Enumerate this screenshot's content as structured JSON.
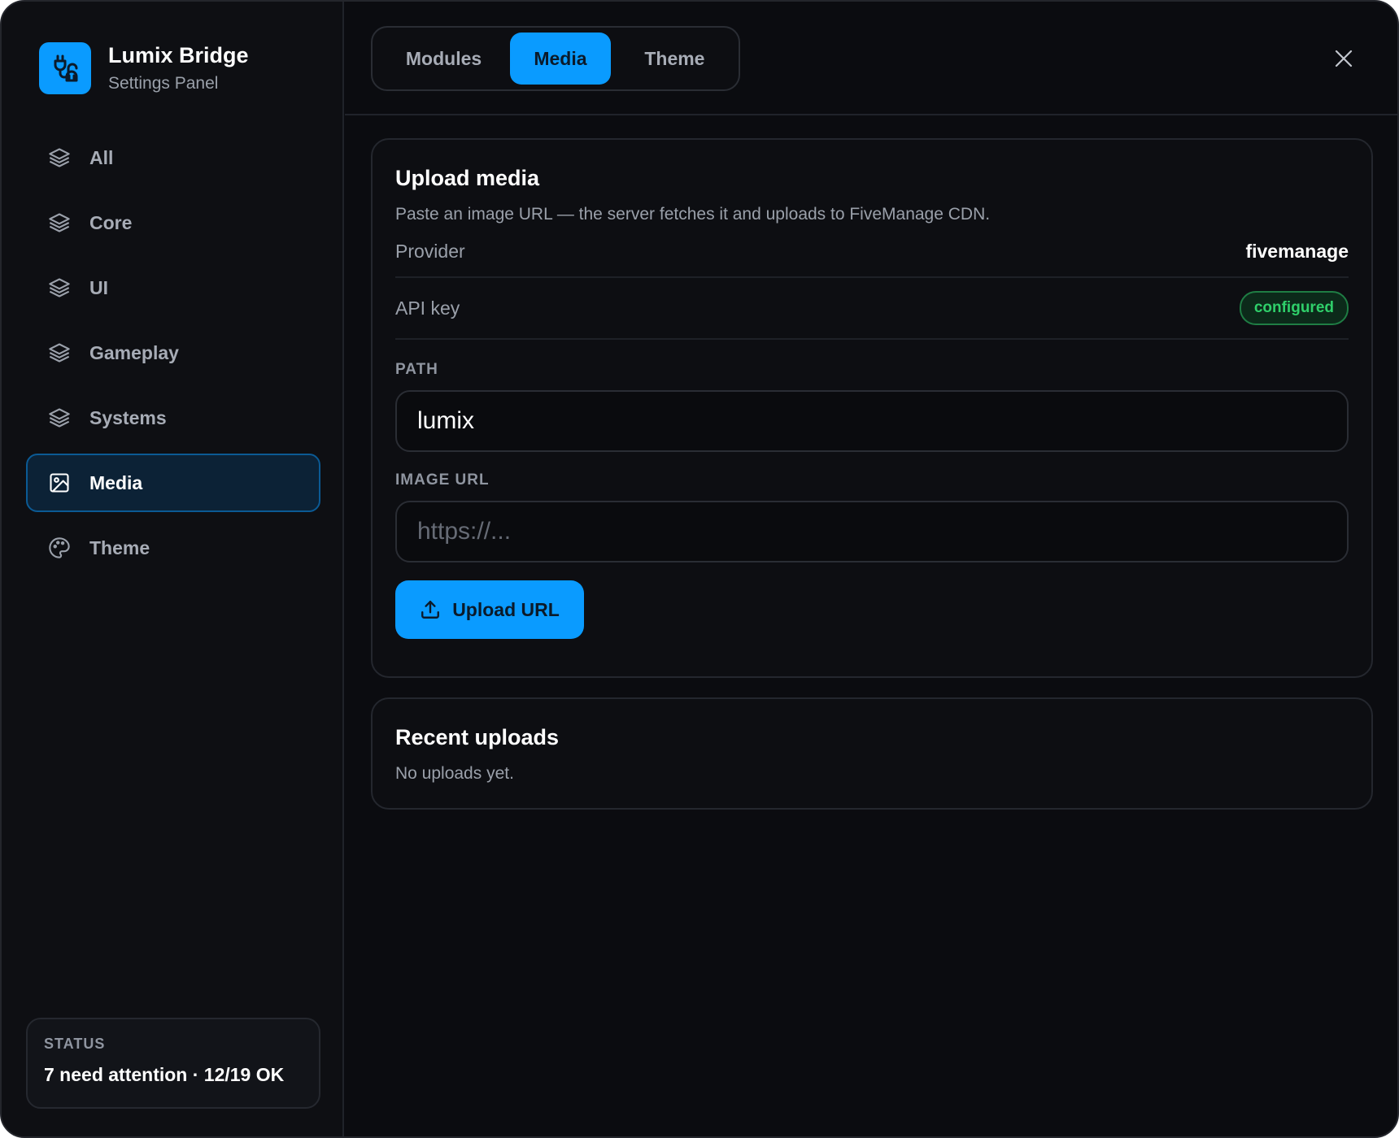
{
  "brand": {
    "title": "Lumix Bridge",
    "subtitle": "Settings Panel"
  },
  "sidebar": {
    "items": [
      {
        "label": "All",
        "icon": "layers-icon"
      },
      {
        "label": "Core",
        "icon": "layers-icon"
      },
      {
        "label": "UI",
        "icon": "layers-icon"
      },
      {
        "label": "Gameplay",
        "icon": "layers-icon"
      },
      {
        "label": "Systems",
        "icon": "layers-icon"
      },
      {
        "label": "Media",
        "icon": "image-icon",
        "active": true
      },
      {
        "label": "Theme",
        "icon": "palette-icon"
      }
    ],
    "status": {
      "label": "STATUS",
      "text": "7 need attention · 12/19 OK"
    }
  },
  "tabs": [
    {
      "label": "Modules"
    },
    {
      "label": "Media",
      "active": true
    },
    {
      "label": "Theme"
    }
  ],
  "upload_card": {
    "title": "Upload media",
    "subtitle": "Paste an image URL — the server fetches it and uploads to FiveManage CDN.",
    "provider_label": "Provider",
    "provider_value": "fivemanage",
    "api_key_label": "API key",
    "api_key_status": "configured",
    "path_label": "PATH",
    "path_value": "lumix",
    "image_url_label": "IMAGE URL",
    "image_url_placeholder": "https://...",
    "upload_button": "Upload URL"
  },
  "recent_card": {
    "title": "Recent uploads",
    "empty_text": "No uploads yet."
  },
  "colors": {
    "accent": "#0a9bff",
    "background": "#0b0c10",
    "success": "#2fcf6a"
  }
}
